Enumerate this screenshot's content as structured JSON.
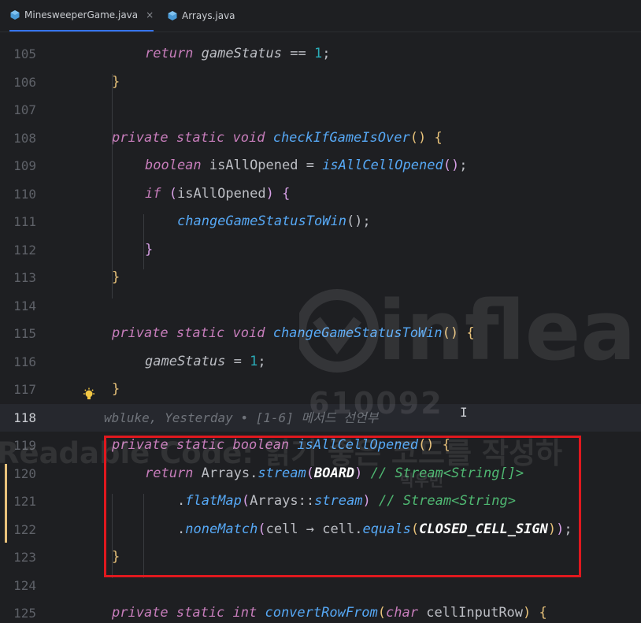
{
  "tabs": [
    {
      "label": "MinesweeperGame.java",
      "active": true,
      "icon": "java-class-icon"
    },
    {
      "label": "Arrays.java",
      "active": false,
      "icon": "java-class-icon"
    }
  ],
  "close_glyph": "×",
  "inlay_hint": "wbluke, Yesterday • [1-6] 메서드 선언부",
  "watermark": {
    "brand": "inflearn",
    "id": "610092",
    "title": "Readable Code: 읽기 좋은 코드를 작성하",
    "author": "박우빈"
  },
  "lines": [
    {
      "n": "105",
      "t": [
        [
          "kw",
          "return "
        ],
        [
          "iv",
          "gameStatus "
        ],
        [
          "pl",
          "== "
        ],
        [
          "num",
          "1"
        ],
        [
          "pl",
          ";"
        ]
      ]
    },
    {
      "n": "106",
      "t": [
        [
          "br1",
          "}"
        ]
      ]
    },
    {
      "n": "107",
      "t": []
    },
    {
      "n": "108",
      "t": [
        [
          "kw",
          "private static void "
        ],
        [
          "fn",
          "checkIfGameIsOver"
        ],
        [
          "br1",
          "()"
        ],
        [
          "pl",
          " "
        ],
        [
          "br1",
          "{"
        ]
      ]
    },
    {
      "n": "109",
      "t": [
        [
          "kw",
          "boolean "
        ],
        [
          "pl",
          "isAllOpened = "
        ],
        [
          "st",
          "isAllCellOpened"
        ],
        [
          "br2",
          "()"
        ],
        [
          "pl",
          ";"
        ]
      ]
    },
    {
      "n": "110",
      "t": [
        [
          "kw",
          "if "
        ],
        [
          "br2",
          "("
        ],
        [
          "pl",
          "isAllOpened"
        ],
        [
          "br2",
          ")"
        ],
        [
          "pl",
          " "
        ],
        [
          "br2",
          "{"
        ]
      ]
    },
    {
      "n": "111",
      "t": [
        [
          "st",
          "changeGameStatusToWin"
        ],
        [
          "pl",
          "();"
        ]
      ]
    },
    {
      "n": "112",
      "t": [
        [
          "br2",
          "}"
        ]
      ]
    },
    {
      "n": "113",
      "t": [
        [
          "br1",
          "}"
        ]
      ]
    },
    {
      "n": "114",
      "t": []
    },
    {
      "n": "115",
      "t": [
        [
          "kw",
          "private static void "
        ],
        [
          "fn",
          "changeGameStatusToWin"
        ],
        [
          "br1",
          "()"
        ],
        [
          "pl",
          " "
        ],
        [
          "br1",
          "{"
        ]
      ]
    },
    {
      "n": "116",
      "t": [
        [
          "iv",
          "gameStatus "
        ],
        [
          "pl",
          "= "
        ],
        [
          "num",
          "1"
        ],
        [
          "pl",
          ";"
        ]
      ]
    },
    {
      "n": "117",
      "t": [
        [
          "br1",
          "}"
        ]
      ]
    },
    {
      "n": "118",
      "t": []
    },
    {
      "n": "119",
      "t": [
        [
          "kw",
          "private static boolean "
        ],
        [
          "fn",
          "isAllCellOpened"
        ],
        [
          "br1",
          "()"
        ],
        [
          "pl",
          " "
        ],
        [
          "br1",
          "{"
        ]
      ]
    },
    {
      "n": "120",
      "t": [
        [
          "kw",
          "return "
        ],
        [
          "pl",
          "Arrays."
        ],
        [
          "st",
          "stream"
        ],
        [
          "br2",
          "("
        ],
        [
          "cn",
          "BOARD"
        ],
        [
          "br2",
          ")"
        ],
        [
          "pl",
          " "
        ],
        [
          "cm",
          "// Stream<String[]>"
        ]
      ]
    },
    {
      "n": "121",
      "t": [
        [
          "pl",
          "."
        ],
        [
          "fn",
          "flatMap"
        ],
        [
          "br2",
          "("
        ],
        [
          "pl",
          "Arrays"
        ],
        [
          "pl",
          "::"
        ],
        [
          "fn",
          "stream"
        ],
        [
          "br2",
          ")"
        ],
        [
          "pl",
          " "
        ],
        [
          "cm",
          "// Stream<String>"
        ]
      ]
    },
    {
      "n": "122",
      "t": [
        [
          "pl",
          "."
        ],
        [
          "fn",
          "noneMatch"
        ],
        [
          "br2",
          "("
        ],
        [
          "pl",
          "cell → cell."
        ],
        [
          "fn",
          "equals"
        ],
        [
          "br1",
          "("
        ],
        [
          "cn",
          "CLOSED_CELL_SIGN"
        ],
        [
          "br1",
          ")"
        ],
        [
          "br2",
          ")"
        ],
        [
          "pl",
          ";"
        ]
      ]
    },
    {
      "n": "123",
      "t": [
        [
          "br1",
          "}"
        ]
      ]
    },
    {
      "n": "124",
      "t": []
    },
    {
      "n": "125",
      "t": [
        [
          "kw",
          "private static int "
        ],
        [
          "fn",
          "convertRowFrom"
        ],
        [
          "br1",
          "("
        ],
        [
          "kw",
          "char "
        ],
        [
          "pl",
          "cellInputRow"
        ],
        [
          "br1",
          ")"
        ],
        [
          "pl",
          " "
        ],
        [
          "br1",
          "{"
        ]
      ]
    }
  ]
}
